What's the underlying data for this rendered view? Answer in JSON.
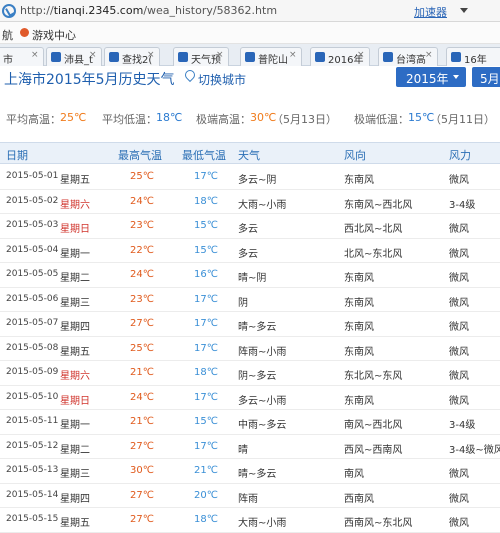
{
  "browser": {
    "url_prefix": "http://",
    "url_host": "tianqi.2345.com",
    "url_path": "/wea_history/58362.htm",
    "accelerator": "加速器",
    "fav_items": [
      "航",
      "游戏中心"
    ],
    "tabs": [
      {
        "label": "市"
      },
      {
        "label": "沛县_t"
      },
      {
        "label": "查找2("
      },
      {
        "label": "天气预"
      },
      {
        "label": "普陀山"
      },
      {
        "label": "2016年"
      },
      {
        "label": "台湾高"
      },
      {
        "label": "16年"
      }
    ]
  },
  "header": {
    "title": "上海市2015年5月历史天气",
    "switch_city": "切换城市",
    "year_select": "2015年",
    "month_select": "5月"
  },
  "stats": {
    "avg_high_label": "平均高温：",
    "avg_high": "25℃",
    "avg_low_label": "平均低温：",
    "avg_low": "18℃",
    "max_high_label": "极端高温：",
    "max_high": "30℃",
    "max_high_date": "（5月13日）",
    "min_low_label": "极端低温：",
    "min_low": "15℃",
    "min_low_date": "（5月11日）"
  },
  "table": {
    "headers": [
      "日期",
      "最高气温",
      "最低气温",
      "天气",
      "风向",
      "风力"
    ],
    "rows": [
      {
        "date": "2015-05-01",
        "weekday": "星期五",
        "high": "25℃",
        "low": "17℃",
        "weather": "多云~阴",
        "wind": "东南风",
        "power": "微风",
        "weekend": false
      },
      {
        "date": "2015-05-02",
        "weekday": "星期六",
        "high": "24℃",
        "low": "18℃",
        "weather": "大雨~小雨",
        "wind": "东南风~西北风",
        "power": "3-4级",
        "weekend": true
      },
      {
        "date": "2015-05-03",
        "weekday": "星期日",
        "high": "23℃",
        "low": "15℃",
        "weather": "多云",
        "wind": "西北风~北风",
        "power": "微风",
        "weekend": true
      },
      {
        "date": "2015-05-04",
        "weekday": "星期一",
        "high": "22℃",
        "low": "15℃",
        "weather": "多云",
        "wind": "北风~东北风",
        "power": "微风",
        "weekend": false
      },
      {
        "date": "2015-05-05",
        "weekday": "星期二",
        "high": "24℃",
        "low": "16℃",
        "weather": "晴~阴",
        "wind": "东南风",
        "power": "微风",
        "weekend": false
      },
      {
        "date": "2015-05-06",
        "weekday": "星期三",
        "high": "23℃",
        "low": "17℃",
        "weather": "阴",
        "wind": "东南风",
        "power": "微风",
        "weekend": false
      },
      {
        "date": "2015-05-07",
        "weekday": "星期四",
        "high": "27℃",
        "low": "17℃",
        "weather": "晴~多云",
        "wind": "东南风",
        "power": "微风",
        "weekend": false
      },
      {
        "date": "2015-05-08",
        "weekday": "星期五",
        "high": "25℃",
        "low": "17℃",
        "weather": "阵雨~小雨",
        "wind": "东南风",
        "power": "微风",
        "weekend": false
      },
      {
        "date": "2015-05-09",
        "weekday": "星期六",
        "high": "21℃",
        "low": "18℃",
        "weather": "阴~多云",
        "wind": "东北风~东风",
        "power": "微风",
        "weekend": true
      },
      {
        "date": "2015-05-10",
        "weekday": "星期日",
        "high": "24℃",
        "low": "17℃",
        "weather": "多云~小雨",
        "wind": "东南风",
        "power": "微风",
        "weekend": true
      },
      {
        "date": "2015-05-11",
        "weekday": "星期一",
        "high": "21℃",
        "low": "15℃",
        "weather": "中雨~多云",
        "wind": "南风~西北风",
        "power": "3-4级",
        "weekend": false
      },
      {
        "date": "2015-05-12",
        "weekday": "星期二",
        "high": "27℃",
        "low": "17℃",
        "weather": "晴",
        "wind": "西风~西南风",
        "power": "3-4级~微风",
        "weekend": false
      },
      {
        "date": "2015-05-13",
        "weekday": "星期三",
        "high": "30℃",
        "low": "21℃",
        "weather": "晴~多云",
        "wind": "南风",
        "power": "微风",
        "weekend": false
      },
      {
        "date": "2015-05-14",
        "weekday": "星期四",
        "high": "27℃",
        "low": "20℃",
        "weather": "阵雨",
        "wind": "西南风",
        "power": "微风",
        "weekend": false
      },
      {
        "date": "2015-05-15",
        "weekday": "星期五",
        "high": "27℃",
        "low": "18℃",
        "weather": "大雨~小雨",
        "wind": "西南风~东北风",
        "power": "微风",
        "weekend": false
      }
    ]
  }
}
